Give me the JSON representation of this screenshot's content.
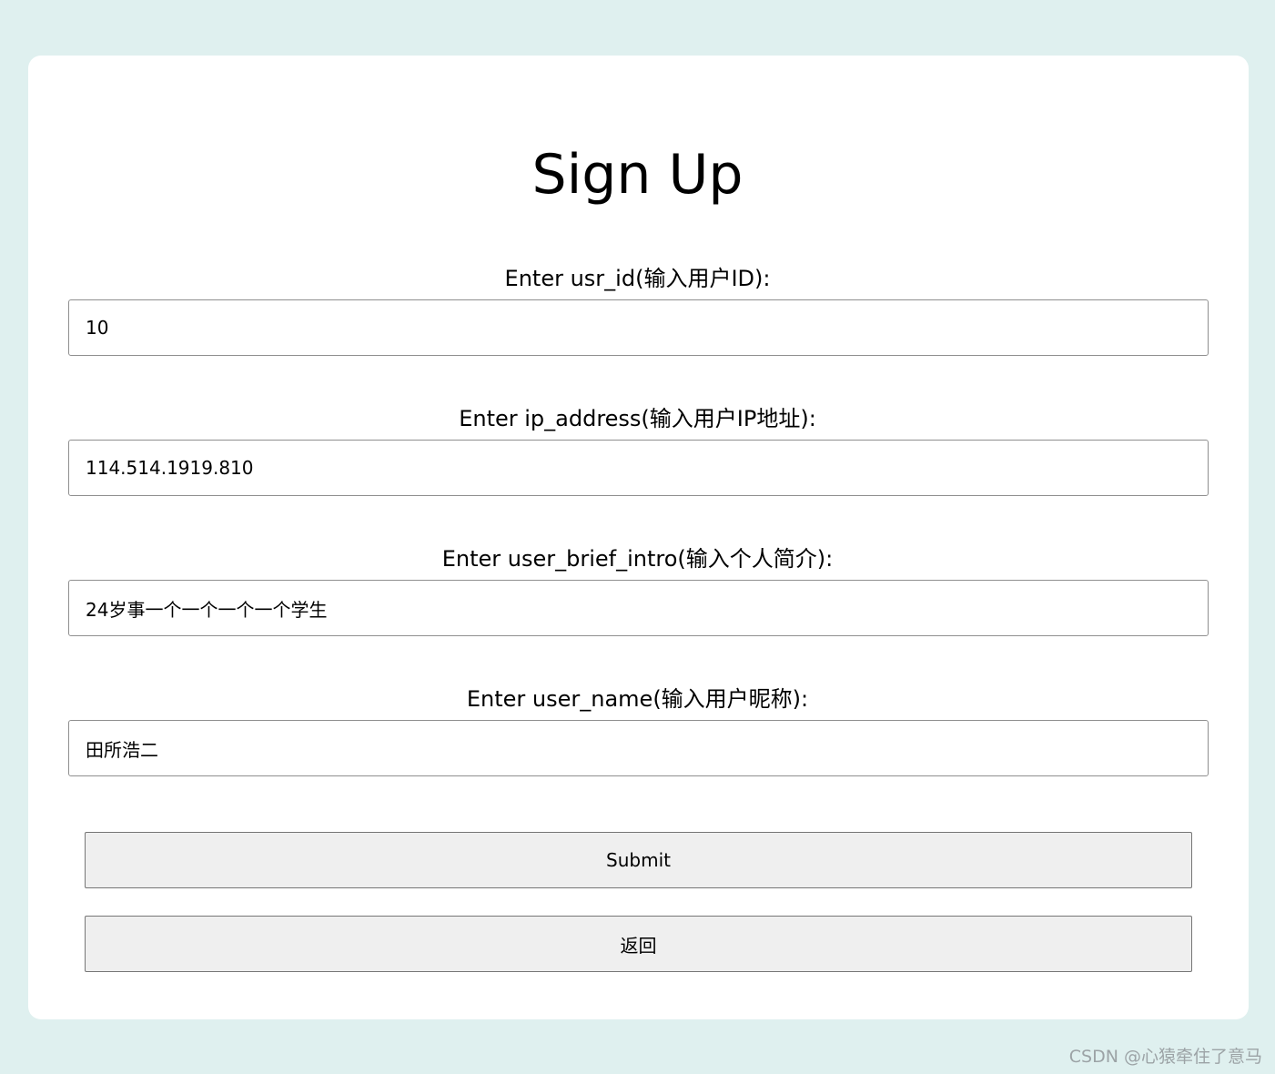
{
  "page": {
    "title": "Sign Up"
  },
  "form": {
    "fields": [
      {
        "label": "Enter usr_id(输入用户ID):",
        "value": "10"
      },
      {
        "label": "Enter ip_address(输入用户IP地址):",
        "value": "114.514.1919.810"
      },
      {
        "label": "Enter user_brief_intro(输入个人简介):",
        "value": "24岁事一个一个一个一个学生"
      },
      {
        "label": "Enter user_name(输入用户昵称):",
        "value": "田所浩二"
      }
    ],
    "submit_label": "Submit",
    "back_label": "返回"
  },
  "watermark": "CSDN @心猿牵住了意马",
  "colors": {
    "background": "#dff0ef",
    "card": "#ffffff",
    "button": "#efefef"
  }
}
